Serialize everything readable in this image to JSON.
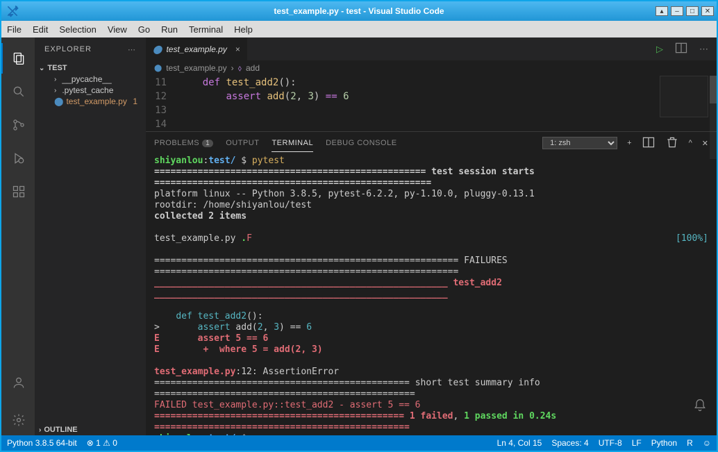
{
  "titlebar": {
    "text": "test_example.py - test - Visual Studio Code"
  },
  "menu": {
    "items": [
      "File",
      "Edit",
      "Selection",
      "View",
      "Go",
      "Run",
      "Terminal",
      "Help"
    ]
  },
  "sidebar": {
    "header": "EXPLORER",
    "project": "TEST",
    "items": [
      {
        "label": "__pycache__",
        "kind": "folder"
      },
      {
        "label": ".pytest_cache",
        "kind": "folder"
      },
      {
        "label": "test_example.py",
        "kind": "modified",
        "badge": "1"
      }
    ],
    "outline": "OUTLINE"
  },
  "tabs": {
    "active": "test_example.py"
  },
  "breadcrumb": {
    "file": "test_example.py",
    "symbol": "add"
  },
  "editor": {
    "lines": [
      {
        "n": "11",
        "pre": "    ",
        "kw": "def",
        "sp": " ",
        "fn": "test_add2",
        "rest": "():"
      },
      {
        "n": "12",
        "pre": "        ",
        "kw": "assert",
        "sp": " ",
        "fn": "add",
        "rest1": "(",
        "n1": "2",
        "c1": ", ",
        "n2": "3",
        "rest2": ") ",
        "op": "==",
        "sp2": " ",
        "n3": "6"
      },
      {
        "n": "13"
      },
      {
        "n": "14"
      }
    ]
  },
  "panel": {
    "tabs": {
      "problems": "PROBLEMS",
      "problems_count": "1",
      "output": "OUTPUT",
      "terminal": "TERMINAL",
      "debug": "DEBUG CONSOLE"
    },
    "shell_select": "1: zsh"
  },
  "terminal": {
    "user": "shiyanlou",
    "dir": "test/",
    "sep": ":",
    "prompt": " $ ",
    "cmd": "pytest",
    "rule1": "================================================== ",
    "session": "test session starts",
    " rule1b": " ===================================================",
    "platform": "platform linux -- Python 3.8.5, pytest-6.2.2, py-1.10.0, pluggy-0.13.1",
    "rootdir": "rootdir: /home/shiyanlou/test",
    "collected": "collected 2 items",
    "file": "test_example.py ",
    "dot": ".",
    "F": "F",
    "pct": "[100%]",
    "failures_rule": "======================================================== ",
    "failures": "FAILURES",
    " failures_ruleb": " ========================================================",
    "test_name_rule": "______________________________________________________ ",
    "test_name": "test_add2",
    " test_name_ruleb": " ______________________________________________________",
    "def_line_pre": "    ",
    "def": "def",
    "def_nm": " test_add2",
    "def_rest": "():",
    "assert_gt": ">       ",
    "assert": "assert",
    "assert_mid": " add(",
    "two": "2",
    "comma": ", ",
    "three": "3",
    "assert_end": ") == ",
    "six": "6",
    "E1": "E       assert 5 == 6",
    "E2": "E        +  where 5 = add(2, 3)",
    "err_file": "test_example.py",
    "err_loc": ":12: AssertionError",
    "short_rule": "=============================================== ",
    "short": "short test summary info",
    " short_ruleb": " ================================================",
    "failed": "FAILED test_example.py::test_add2 - assert 5 == 6",
    "summary_rule": "============================================== ",
    "one_failed": "1 failed",
    "comma2": ", ",
    "one_passed": "1 passed",
    "in": " in 0.24s",
    " summary_ruleb": " ===============================================",
    "cursor": "▯"
  },
  "status": {
    "python": "Python 3.8.5 64-bit",
    "err": "1",
    "warn": "0",
    "ln": "Ln 4, Col 15",
    "spaces": "Spaces: 4",
    "enc": "UTF-8",
    "eol": "LF",
    "lang": "Python",
    "r": "R"
  }
}
